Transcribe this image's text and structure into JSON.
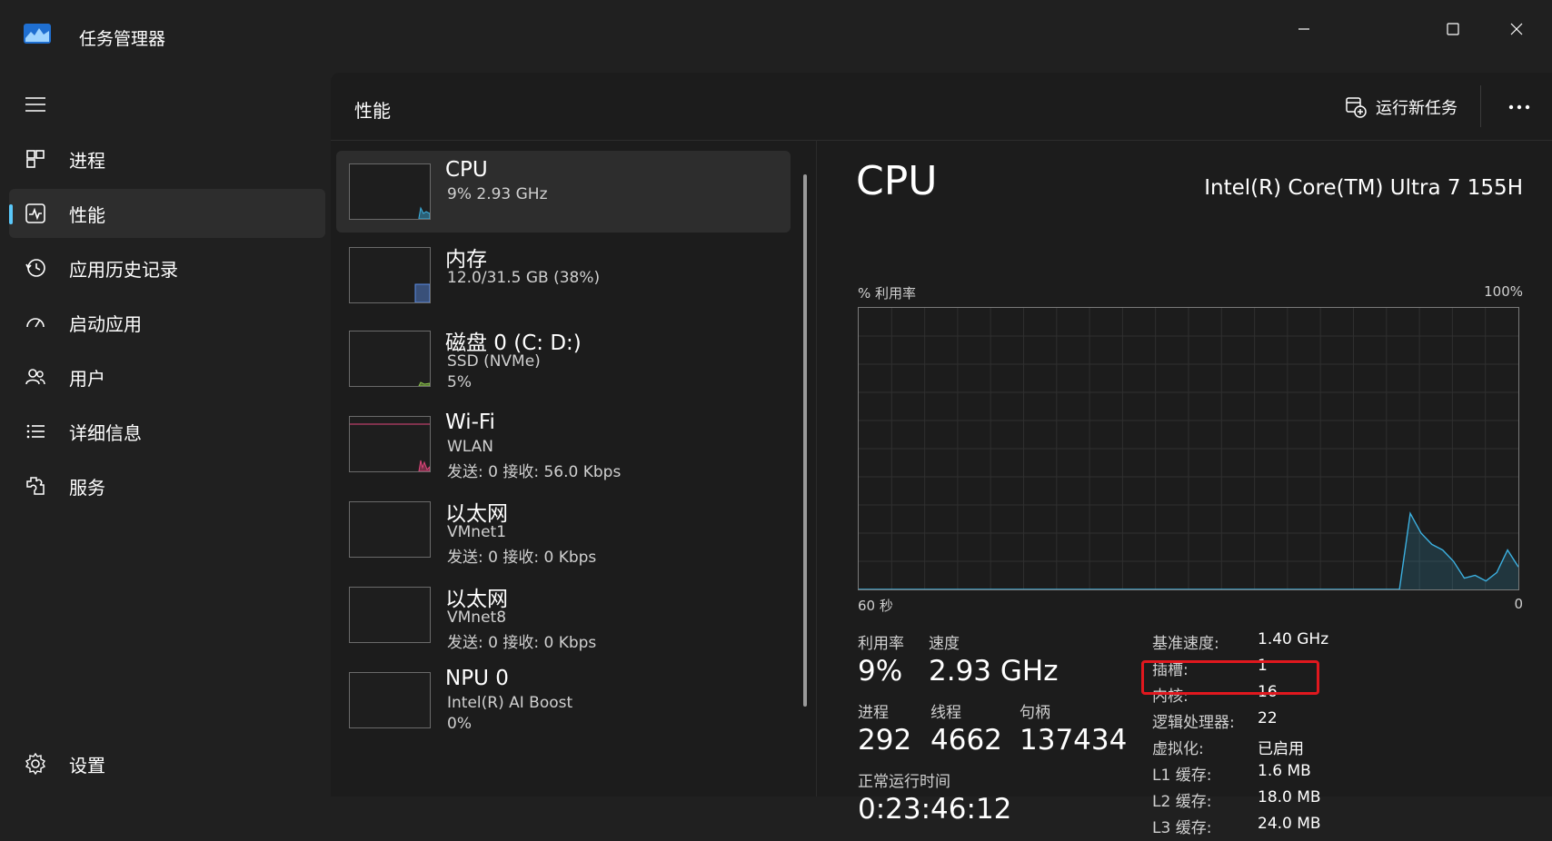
{
  "app": {
    "title": "任务管理器"
  },
  "sidebar": {
    "items": [
      {
        "label": "进程",
        "icon": "processes-icon",
        "active": false
      },
      {
        "label": "性能",
        "icon": "performance-icon",
        "active": true
      },
      {
        "label": "应用历史记录",
        "icon": "app-history-icon",
        "active": false
      },
      {
        "label": "启动应用",
        "icon": "startup-apps-icon",
        "active": false
      },
      {
        "label": "用户",
        "icon": "users-icon",
        "active": false
      },
      {
        "label": "详细信息",
        "icon": "details-icon",
        "active": false
      },
      {
        "label": "服务",
        "icon": "services-icon",
        "active": false
      }
    ],
    "settings_label": "设置"
  },
  "header": {
    "title": "性能",
    "run_task_label": "运行新任务"
  },
  "devices": [
    {
      "name": "CPU",
      "lines": [
        "9%  2.93 GHz"
      ],
      "color": "#3cb0e0",
      "active": true
    },
    {
      "name": "内存",
      "lines": [
        "12.0/31.5 GB (38%)"
      ],
      "color": "#5a8de8",
      "active": false
    },
    {
      "name": "磁盘 0 (C: D:)",
      "lines": [
        "SSD (NVMe)",
        "5%"
      ],
      "color": "#8bc34a",
      "active": false
    },
    {
      "name": "Wi-Fi",
      "lines": [
        "WLAN",
        "发送: 0 接收: 56.0 Kbps"
      ],
      "color": "#e0457b",
      "active": false
    },
    {
      "name": "以太网",
      "lines": [
        "VMnet1",
        "发送: 0 接收: 0 Kbps"
      ],
      "color": "#e0457b",
      "active": false
    },
    {
      "name": "以太网",
      "lines": [
        "VMnet8",
        "发送: 0 接收: 0 Kbps"
      ],
      "color": "#e0457b",
      "active": false
    },
    {
      "name": "NPU 0",
      "lines": [
        "Intel(R) AI Boost",
        "0%"
      ],
      "color": "#3cb0e0",
      "active": false
    }
  ],
  "detail": {
    "title": "CPU",
    "model": "Intel(R) Core(TM) Ultra 7 155H",
    "graph": {
      "y_label": "% 利用率",
      "y_max_label": "100%",
      "x_label": "60 秒",
      "x_min_label": "0",
      "line_color": "#3cb0e0",
      "utilization_history_pct": [
        0,
        0,
        0,
        0,
        0,
        0,
        0,
        0,
        0,
        0,
        0,
        0,
        0,
        0,
        0,
        0,
        0,
        0,
        0,
        0,
        0,
        0,
        0,
        0,
        0,
        0,
        0,
        0,
        0,
        0,
        0,
        0,
        0,
        0,
        0,
        0,
        0,
        0,
        0,
        0,
        0,
        0,
        0,
        0,
        0,
        0,
        0,
        0,
        0,
        0,
        0,
        27,
        20,
        16,
        14,
        10,
        4,
        5,
        3,
        6,
        14,
        8
      ]
    },
    "stats": {
      "utilization": {
        "label": "利用率",
        "value": "9%"
      },
      "speed": {
        "label": "速度",
        "value": "2.93 GHz"
      },
      "processes": {
        "label": "进程",
        "value": "292"
      },
      "threads": {
        "label": "线程",
        "value": "4662"
      },
      "handles": {
        "label": "句柄",
        "value": "137434"
      },
      "uptime": {
        "label": "正常运行时间",
        "value": "0:23:46:12"
      }
    },
    "specs": [
      {
        "key": "基准速度:",
        "value": "1.40 GHz"
      },
      {
        "key": "插槽:",
        "value": "1"
      },
      {
        "key": "内核:",
        "value": "16"
      },
      {
        "key": "逻辑处理器:",
        "value": "22"
      },
      {
        "key": "虚拟化:",
        "value": "已启用"
      },
      {
        "key": "L1 缓存:",
        "value": "1.6 MB"
      },
      {
        "key": "L2 缓存:",
        "value": "18.0 MB"
      },
      {
        "key": "L3 缓存:",
        "value": "24.0 MB"
      }
    ],
    "highlight_color": "#e0181e"
  }
}
